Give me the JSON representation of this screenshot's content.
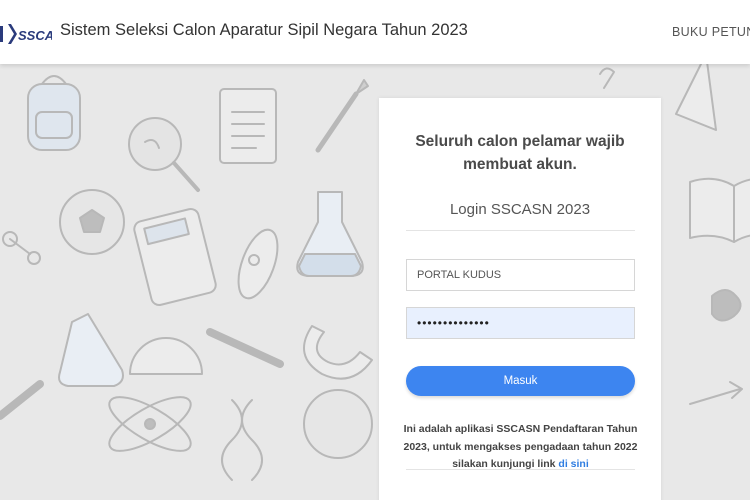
{
  "header": {
    "logo_text": "SSCASN",
    "title": "Sistem Seleksi Calon Aparatur Sipil Negara Tahun 2023",
    "nav_link": "BUKU PETUN"
  },
  "login": {
    "message": "Seluruh calon pelamar wajib membuat akun.",
    "title": "Login SSCASN 2023",
    "username_value": "PORTAL KUDUS",
    "password_value": "••••••••••••••",
    "button_label": "Masuk",
    "info_text": "Ini adalah aplikasi SSCASN Pendaftaran Tahun 2023, untuk mengakses pengadaan tahun 2022 silakan kunjungi link",
    "info_link": "di sini"
  },
  "colors": {
    "accent": "#3d85f0",
    "link": "#2f7de1",
    "autofill": "#e8f0fe"
  }
}
